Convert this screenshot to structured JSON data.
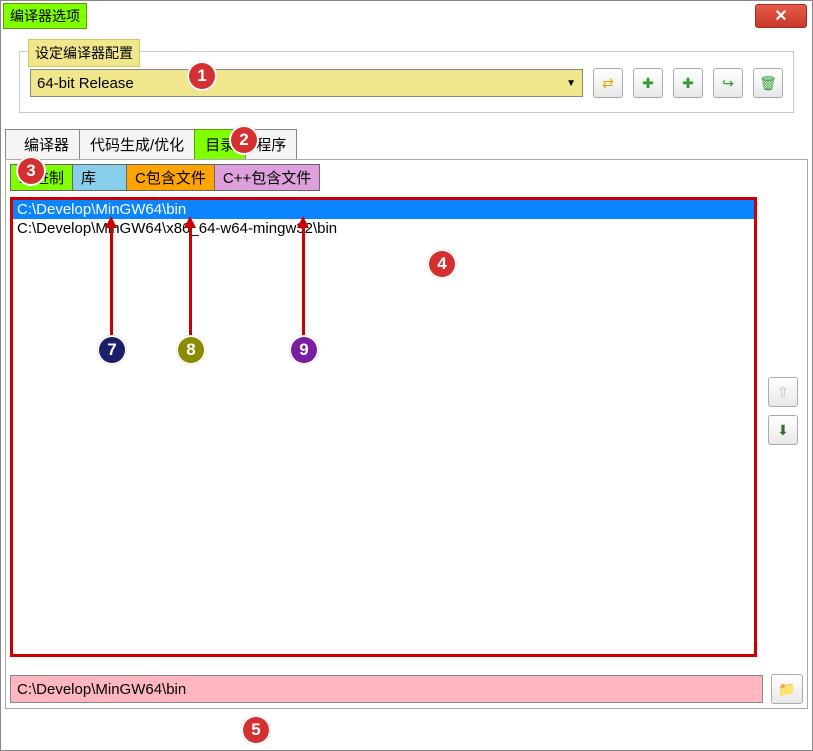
{
  "window": {
    "title": "编译器选项"
  },
  "config": {
    "label": "设定编译器配置",
    "selected": "64-bit Release"
  },
  "main_tabs": [
    "编译器",
    "代码生成/优化",
    "目录",
    "程序"
  ],
  "main_tab_active": 2,
  "sub_tabs": {
    "binary": "二进制",
    "lib": "库",
    "c_include": "C包含文件",
    "cpp_include": "C++包含文件"
  },
  "paths": [
    "C:\\Develop\\MinGW64\\bin",
    "C:\\Develop\\MinGW64\\x86_64-w64-mingw32\\bin"
  ],
  "selected_path_index": 0,
  "bottom_input": "C:\\Develop\\MinGW64\\bin",
  "callouts": {
    "1": "1",
    "2": "2",
    "3": "3",
    "4": "4",
    "5": "5",
    "7": "7",
    "8": "8",
    "9": "9"
  },
  "icons": {
    "left_right": "⇄",
    "plus": "✚",
    "plus2": "✚",
    "rename": "↪",
    "delete": "🗑",
    "up": "⇧",
    "down": "⬇",
    "browse": "📁"
  }
}
